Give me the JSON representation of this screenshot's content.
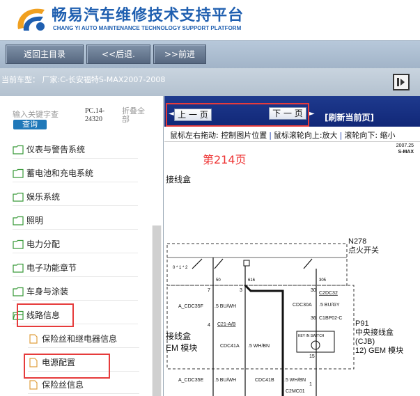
{
  "header": {
    "title": "畅易汽车维修技术支持平台",
    "subtitle": "CHANG YI AUTO MAINTENANCE TECHNOLOGY SUPPORT PLATFORM"
  },
  "toolbar": {
    "home_label": "返回主目录",
    "back_label": "<<后退.",
    "forward_label": ">>前进"
  },
  "model_bar": {
    "label": "当前车型：  厂家:C-长安福特S-MAX2007-2008"
  },
  "sidebar": {
    "search_placeholder": "输入关键字查",
    "search_button": "查询",
    "pc_code": "PC.14-24320",
    "collapse_all": "折叠全部",
    "items": [
      {
        "label": "仪表与警告系统"
      },
      {
        "label": "蓄电池和充电系统"
      },
      {
        "label": "娱乐系统"
      },
      {
        "label": "照明"
      },
      {
        "label": "电力分配"
      },
      {
        "label": "电子功能章节"
      },
      {
        "label": "车身与涂装"
      },
      {
        "label": "线路信息"
      }
    ],
    "sub_items": [
      {
        "label": "保险丝和继电器信息"
      },
      {
        "label": "电源配置"
      },
      {
        "label": "保险丝信息"
      }
    ]
  },
  "main": {
    "prev_page": "上 一 页",
    "next_page": "下 一 页",
    "refresh": "[刷新当前页]",
    "hint_drag": "鼠标左右拖动: 控制图片位置",
    "hint_zoom_in": "鼠标滚轮向上:放大",
    "hint_zoom_out": "滚轮向下: 缩小",
    "page_number": "第214页"
  },
  "diagram": {
    "year": "2007.25",
    "model": "S-MAX",
    "left_text_1": "接线盒",
    "left_text_2": "接线盒",
    "left_text_3": "EM 模块",
    "n278": "N278",
    "ignition": "点火开关",
    "p91": "P91",
    "p91_desc_1": "中央接线盒",
    "p91_desc_2": "(CJB)",
    "p91_desc_3": "12) GEM 模块",
    "key_in_switch": "KEY IN SWITCH",
    "pins": {
      "p7": "7",
      "p3": "3",
      "p30": "30",
      "p50": "50",
      "p15": "15",
      "p4": "4",
      "p36": "36",
      "p1": "1"
    },
    "nums": {
      "n50": "50",
      "n616": "616",
      "n305": "305"
    },
    "wires": {
      "w1": "A_CDC35F",
      "w1c": ".5 BU/WH",
      "w2": "C21-A/B",
      "w3": "CDC41A",
      "w3c": ".5 WH/BN",
      "w4": "C2DC32",
      "w5": "CDC30A",
      "w5c": ".5 BU/GY",
      "w6": "C1BP02-C",
      "w7": "A_CDC35E",
      "w7c": ".5 BU/WH",
      "w8": "CDC41B",
      "w8c": ".5 WH/BN",
      "w9": "C2MC01"
    }
  },
  "colors": {
    "brand_blue": "#1f5fb0",
    "nav_blue": "#112777",
    "highlight_red": "#e63b3b"
  }
}
